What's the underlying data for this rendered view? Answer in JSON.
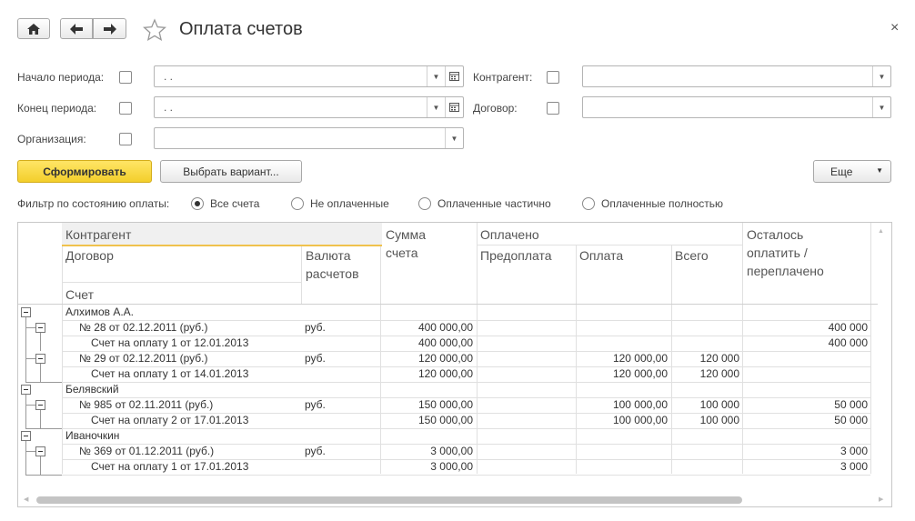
{
  "window": {
    "title": "Оплата счетов",
    "close_glyph": "×"
  },
  "filters": {
    "period_start_label": "Начало периода:",
    "period_end_label": "Конец периода:",
    "organization_label": "Организация:",
    "contractor_label": "Контрагент:",
    "contract_label": "Договор:",
    "period_start_value": ". .",
    "period_end_value": ". .",
    "organization_value": "",
    "contractor_value": "",
    "contract_value": ""
  },
  "toolbar": {
    "generate_label": "Сформировать",
    "choose_variant_label": "Выбрать вариант...",
    "more_label": "Еще"
  },
  "payment_filter": {
    "label": "Фильтр по состоянию оплаты:",
    "options": [
      "Все счета",
      "Не оплаченные",
      "Оплаченные частично",
      "Оплаченные полностью"
    ],
    "selected": "Все счета"
  },
  "report": {
    "headers": {
      "contractor": "Контрагент",
      "contract": "Договор",
      "currency": "Валюта расчетов",
      "invoice": "Счет",
      "sum": "Сумма счета",
      "paid": "Оплачено",
      "prepay": "Предоплата",
      "payment": "Оплата",
      "total": "Всего",
      "remaining": "Осталось оплатить / переплачено"
    },
    "rows": [
      {
        "level": 0,
        "name": "Алхимов А.А.",
        "currency": "",
        "sum": "",
        "prepay": "",
        "payment": "",
        "total": "",
        "remaining": ""
      },
      {
        "level": 1,
        "name": "№ 28 от 02.12.2011 (руб.)",
        "currency": "руб.",
        "sum": "400 000,00",
        "prepay": "",
        "payment": "",
        "total": "",
        "remaining": "400 000"
      },
      {
        "level": 2,
        "name": "Счет на оплату 1 от 12.01.2013",
        "currency": "",
        "sum": "400 000,00",
        "prepay": "",
        "payment": "",
        "total": "",
        "remaining": "400 000"
      },
      {
        "level": 1,
        "name": "№ 29 от 02.12.2011 (руб.)",
        "currency": "руб.",
        "sum": "120 000,00",
        "prepay": "",
        "payment": "120 000,00",
        "total": "120 000",
        "remaining": ""
      },
      {
        "level": 2,
        "name": "Счет на оплату 1 от 14.01.2013",
        "currency": "",
        "sum": "120 000,00",
        "prepay": "",
        "payment": "120 000,00",
        "total": "120 000",
        "remaining": ""
      },
      {
        "level": 0,
        "name": "Белявский",
        "currency": "",
        "sum": "",
        "prepay": "",
        "payment": "",
        "total": "",
        "remaining": ""
      },
      {
        "level": 1,
        "name": "№ 985 от 02.11.2011 (руб.)",
        "currency": "руб.",
        "sum": "150 000,00",
        "prepay": "",
        "payment": "100 000,00",
        "total": "100 000",
        "remaining": "50 000"
      },
      {
        "level": 2,
        "name": "Счет на оплату 2 от 17.01.2013",
        "currency": "",
        "sum": "150 000,00",
        "prepay": "",
        "payment": "100 000,00",
        "total": "100 000",
        "remaining": "50 000"
      },
      {
        "level": 0,
        "name": "Иваночкин",
        "currency": "",
        "sum": "",
        "prepay": "",
        "payment": "",
        "total": "",
        "remaining": ""
      },
      {
        "level": 1,
        "name": "№ 369 от 01.12.2011 (руб.)",
        "currency": "руб.",
        "sum": "3 000,00",
        "prepay": "",
        "payment": "",
        "total": "",
        "remaining": "3 000"
      },
      {
        "level": 2,
        "name": "Счет на оплату 1 от 17.01.2013",
        "currency": "",
        "sum": "3 000,00",
        "prepay": "",
        "payment": "",
        "total": "",
        "remaining": "3 000"
      }
    ]
  },
  "colors": {
    "accent_button": "#f5d53a",
    "header_underline": "#f0c24c"
  }
}
